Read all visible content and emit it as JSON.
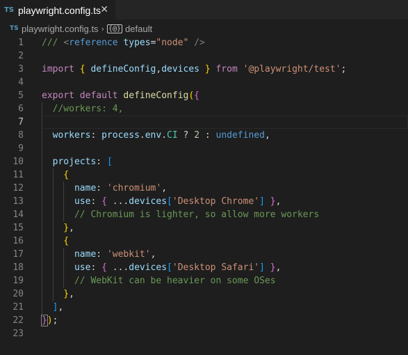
{
  "tab": {
    "badge": "TS",
    "filename": "playwright.config.ts",
    "close": "✕"
  },
  "breadcrumb": {
    "badge": "TS",
    "file": "playwright.config.ts",
    "separator": "›",
    "symbol_icon": "{@}",
    "symbol": "default"
  },
  "lines": [
    {
      "n": "1",
      "tokens": [
        [
          "c-comment",
          "/// "
        ],
        [
          "c-tag",
          "<"
        ],
        [
          "c-kw",
          "reference "
        ],
        [
          "c-var",
          "types"
        ],
        [
          "c-pun",
          "="
        ],
        [
          "c-str",
          "\"node\""
        ],
        [
          "c-tag",
          " />"
        ]
      ]
    },
    {
      "n": "2",
      "tokens": []
    },
    {
      "n": "3",
      "tokens": [
        [
          "c-kw2",
          "import "
        ],
        [
          "c-b1",
          "{ "
        ],
        [
          "c-var",
          "defineConfig"
        ],
        [
          "c-pun",
          ","
        ],
        [
          "c-var",
          "devices "
        ],
        [
          "c-b1",
          "}"
        ],
        [
          "c-kw2",
          " from "
        ],
        [
          "c-str",
          "'@playwright/test'"
        ],
        [
          "c-pun",
          ";"
        ]
      ]
    },
    {
      "n": "4",
      "tokens": []
    },
    {
      "n": "5",
      "tokens": [
        [
          "c-kw2",
          "export "
        ],
        [
          "c-kw2",
          "default "
        ],
        [
          "c-fn",
          "defineConfig"
        ],
        [
          "c-b1",
          "("
        ],
        [
          "c-b2",
          "{"
        ]
      ]
    },
    {
      "n": "6",
      "tokens": [
        [
          "c-comment",
          "  //workers: 4,"
        ]
      ]
    },
    {
      "n": "7",
      "tokens": []
    },
    {
      "n": "8",
      "tokens": [
        [
          "c-var",
          "  workers"
        ],
        [
          "c-pun",
          ": "
        ],
        [
          "c-var",
          "process"
        ],
        [
          "c-pun",
          "."
        ],
        [
          "c-var",
          "env"
        ],
        [
          "c-pun",
          "."
        ],
        [
          "c-type",
          "CI"
        ],
        [
          "c-pun",
          " ? "
        ],
        [
          "c-num",
          "2"
        ],
        [
          "c-pun",
          " : "
        ],
        [
          "c-kw",
          "undefined"
        ],
        [
          "c-pun",
          ","
        ]
      ]
    },
    {
      "n": "9",
      "tokens": []
    },
    {
      "n": "10",
      "tokens": [
        [
          "c-var",
          "  projects"
        ],
        [
          "c-pun",
          ": "
        ],
        [
          "c-b3",
          "["
        ]
      ]
    },
    {
      "n": "11",
      "tokens": [
        [
          "c-b1",
          "    {"
        ]
      ]
    },
    {
      "n": "12",
      "tokens": [
        [
          "c-var",
          "      name"
        ],
        [
          "c-pun",
          ": "
        ],
        [
          "c-str",
          "'chromium'"
        ],
        [
          "c-pun",
          ","
        ]
      ]
    },
    {
      "n": "13",
      "tokens": [
        [
          "c-var",
          "      use"
        ],
        [
          "c-pun",
          ": "
        ],
        [
          "c-b2",
          "{ "
        ],
        [
          "c-pun",
          "..."
        ],
        [
          "c-var",
          "devices"
        ],
        [
          "c-b3",
          "["
        ],
        [
          "c-str",
          "'Desktop Chrome'"
        ],
        [
          "c-b3",
          "]"
        ],
        [
          "c-b2",
          " }"
        ],
        [
          "c-pun",
          ","
        ]
      ]
    },
    {
      "n": "14",
      "tokens": [
        [
          "c-comment",
          "      // Chromium is lighter, so allow more workers"
        ]
      ]
    },
    {
      "n": "15",
      "tokens": [
        [
          "c-b1",
          "    }"
        ],
        [
          "c-pun",
          ","
        ]
      ]
    },
    {
      "n": "16",
      "tokens": [
        [
          "c-b1",
          "    {"
        ]
      ]
    },
    {
      "n": "17",
      "tokens": [
        [
          "c-var",
          "      name"
        ],
        [
          "c-pun",
          ": "
        ],
        [
          "c-str",
          "'webkit'"
        ],
        [
          "c-pun",
          ","
        ]
      ]
    },
    {
      "n": "18",
      "tokens": [
        [
          "c-var",
          "      use"
        ],
        [
          "c-pun",
          ": "
        ],
        [
          "c-b2",
          "{ "
        ],
        [
          "c-pun",
          "..."
        ],
        [
          "c-var",
          "devices"
        ],
        [
          "c-b3",
          "["
        ],
        [
          "c-str",
          "'Desktop Safari'"
        ],
        [
          "c-b3",
          "]"
        ],
        [
          "c-b2",
          " }"
        ],
        [
          "c-pun",
          ","
        ]
      ]
    },
    {
      "n": "19",
      "tokens": [
        [
          "c-comment",
          "      // WebKit can be heavier on some OSes"
        ]
      ]
    },
    {
      "n": "20",
      "tokens": [
        [
          "c-b1",
          "    }"
        ],
        [
          "c-pun",
          ","
        ]
      ]
    },
    {
      "n": "21",
      "tokens": [
        [
          "c-b3",
          "  ]"
        ],
        [
          "c-pun",
          ","
        ]
      ]
    },
    {
      "n": "22",
      "tokens": [
        [
          "c-b2 boxed",
          "}"
        ],
        [
          "c-b1",
          ")"
        ],
        [
          "c-pun",
          ";"
        ]
      ]
    },
    {
      "n": "23",
      "tokens": []
    }
  ],
  "active_line": "7",
  "colors": {
    "background": "#1e1e1e",
    "tabbar": "#252526",
    "ts_badge": "#519aba"
  }
}
